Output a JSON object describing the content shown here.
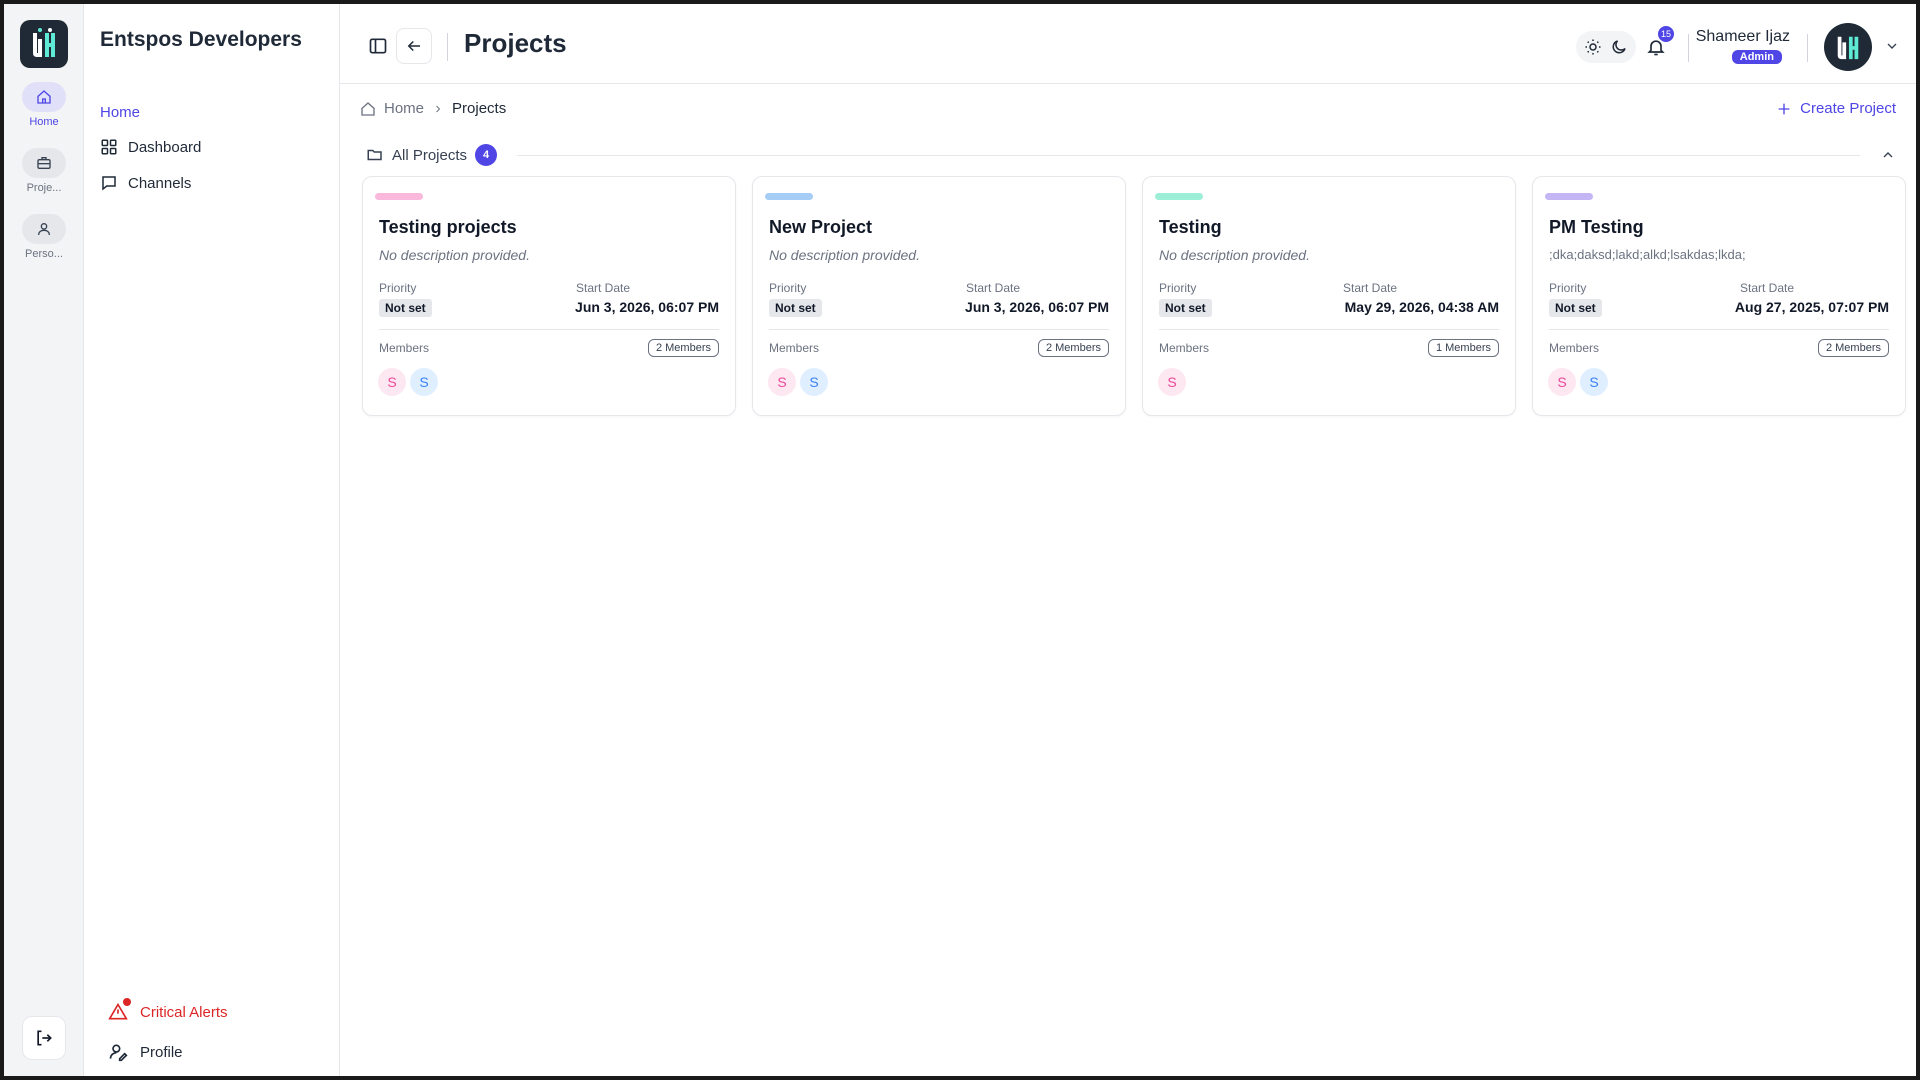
{
  "rail": {
    "items": [
      {
        "label": "Home",
        "icon": "home-icon"
      },
      {
        "label": "Proje...",
        "icon": "briefcase-icon"
      },
      {
        "label": "Perso...",
        "icon": "person-icon"
      }
    ]
  },
  "sidebar": {
    "org_name": "Entspos Developers",
    "section": "Home",
    "links": [
      {
        "label": "Dashboard",
        "icon": "grid-icon"
      },
      {
        "label": "Channels",
        "icon": "chat-icon"
      }
    ],
    "critical_alerts": "Critical Alerts",
    "profile": "Profile"
  },
  "header": {
    "title": "Projects",
    "notification_count": "15",
    "user_name": "Shameer Ijaz",
    "user_role": "Admin"
  },
  "breadcrumb": {
    "home": "Home",
    "current": "Projects"
  },
  "actions": {
    "create_project": "Create Project"
  },
  "section": {
    "label": "All Projects",
    "count": "4"
  },
  "labels": {
    "priority": "Priority",
    "start_date": "Start Date",
    "members": "Members"
  },
  "projects": [
    {
      "title": "Testing projects",
      "description": "No description provided.",
      "priority": "Not set",
      "start_date": "Jun 3, 2026, 06:07 PM",
      "members_count": "2 Members",
      "accent": "#f9b8dc",
      "avatars": [
        "S",
        "S"
      ]
    },
    {
      "title": "New Project",
      "description": "No description provided.",
      "priority": "Not set",
      "start_date": "Jun 3, 2026, 06:07 PM",
      "members_count": "2 Members",
      "accent": "#a5cdf5",
      "avatars": [
        "S",
        "S"
      ]
    },
    {
      "title": "Testing",
      "description": "No description provided.",
      "priority": "Not set",
      "start_date": "May 29, 2026, 04:38 AM",
      "members_count": "1 Members",
      "accent": "#9cefd6",
      "avatars": [
        "S"
      ]
    },
    {
      "title": "PM Testing",
      "description": ";dka;daksd;lakd;alkd;lsakdas;lkda;",
      "priority": "Not set",
      "start_date": "Aug 27, 2025, 07:07 PM",
      "members_count": "2 Members",
      "accent": "#c4b5f5",
      "avatars": [
        "S",
        "S"
      ]
    }
  ],
  "colors": {
    "accent": "#4f46e5",
    "danger": "#dc2626",
    "avatar_pink_bg": "#fde7f1",
    "avatar_pink_fg": "#ec4899",
    "avatar_blue_bg": "#e0efff",
    "avatar_blue_fg": "#3b82f6"
  }
}
